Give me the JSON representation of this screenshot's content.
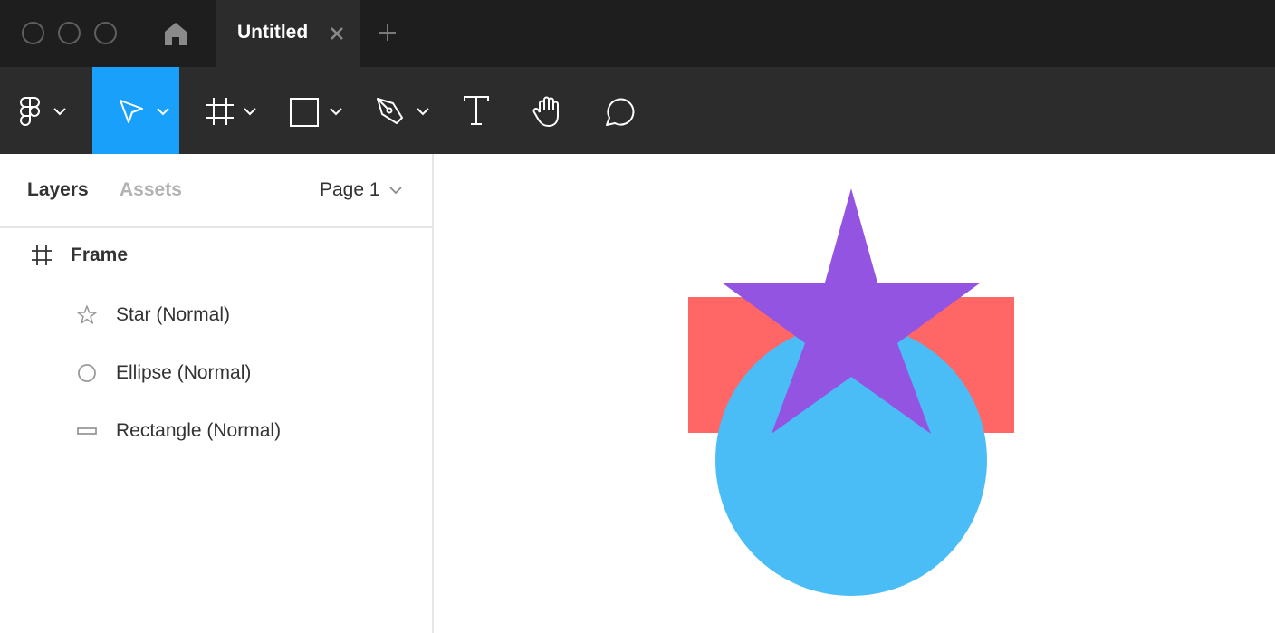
{
  "titlebar": {
    "window_controls": [
      "close-icon",
      "minimize-icon",
      "zoom-icon"
    ],
    "home_icon": "home-icon",
    "tab": {
      "title": "Untitled",
      "close_icon": "close-icon"
    },
    "new_tab_icon": "plus-icon"
  },
  "toolbar": {
    "tools": [
      {
        "name": "main-menu",
        "icon": "figma-logo-icon",
        "dropdown": true,
        "active": false
      },
      {
        "name": "move",
        "icon": "cursor-arrow-icon",
        "dropdown": true,
        "active": true
      },
      {
        "name": "frame",
        "icon": "frame-icon",
        "dropdown": true,
        "active": false
      },
      {
        "name": "shape",
        "icon": "rectangle-icon",
        "dropdown": true,
        "active": false
      },
      {
        "name": "pen",
        "icon": "pen-icon",
        "dropdown": true,
        "active": false
      },
      {
        "name": "text",
        "icon": "text-icon",
        "dropdown": false,
        "active": false
      },
      {
        "name": "hand",
        "icon": "hand-icon",
        "dropdown": false,
        "active": false
      },
      {
        "name": "comment",
        "icon": "comment-icon",
        "dropdown": false,
        "active": false
      }
    ],
    "active_color": "#18a0fb"
  },
  "sidebar": {
    "tabs": [
      "Layers",
      "Assets"
    ],
    "active_tab": "Layers",
    "page": "Page 1",
    "layers": [
      {
        "label": "Frame",
        "icon": "frame-icon",
        "level": 0
      },
      {
        "label": "Star (Normal)",
        "icon": "star-icon",
        "level": 1
      },
      {
        "label": "Ellipse (Normal)",
        "icon": "ellipse-icon",
        "level": 1
      },
      {
        "label": "Rectangle (Normal)",
        "icon": "rectangle-icon",
        "level": 1
      }
    ]
  },
  "canvas": {
    "shapes": [
      {
        "type": "rectangle",
        "color": "#ff6666"
      },
      {
        "type": "ellipse",
        "color": "#4bbdf6"
      },
      {
        "type": "star",
        "color": "#9354e2"
      }
    ]
  }
}
